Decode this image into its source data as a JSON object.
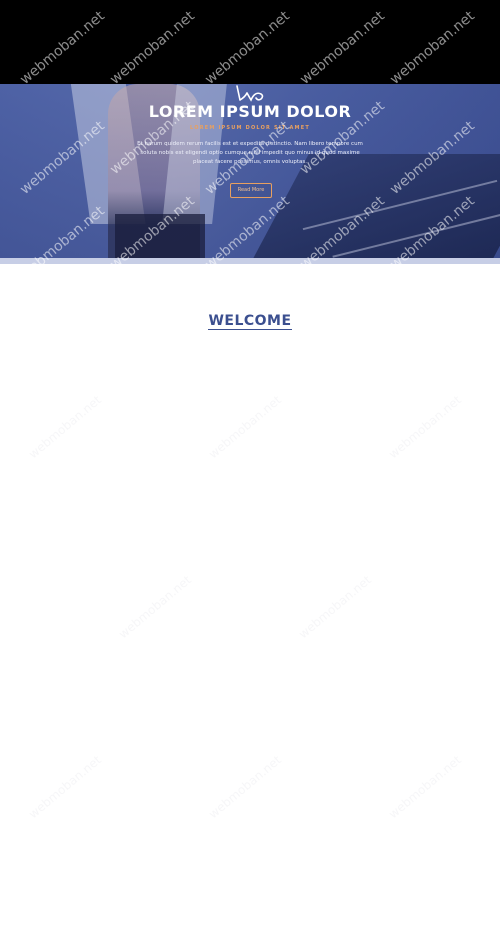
{
  "hero": {
    "title": "LOREM IPSUM DOLOR",
    "subtitle": "LOREM IPSUM DOLOR SIT AMET",
    "body": "Et harum quidem rerum facilis est et expedita distinctio. Nam libero tempore cum soluta nobis est eligendi optio cumque nihil impedit quo minus id quod maxime placeat facere possimus, omnis voluptas.",
    "read_more_label": "Read More"
  },
  "welcome": {
    "heading": "WELCOME"
  },
  "watermark": {
    "text": "webmoban.net"
  },
  "colors": {
    "accent": "#e8a060",
    "heading_blue": "#3b4f8f",
    "hero_overlay": "#4a5ca0",
    "top_bar": "#000000"
  }
}
